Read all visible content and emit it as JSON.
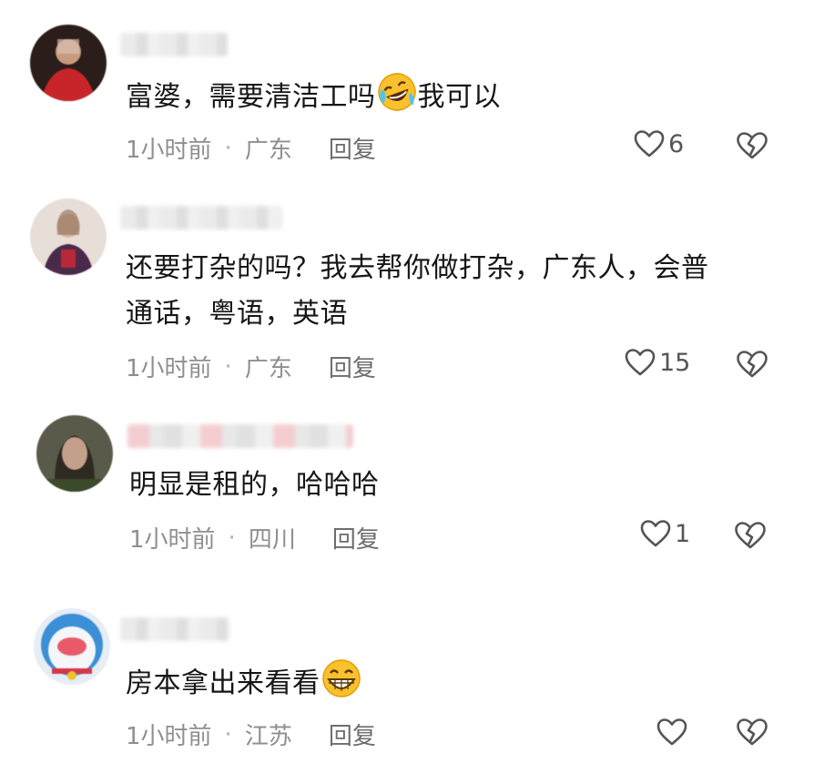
{
  "comments": [
    {
      "text": "富婆，需要清洁工吗",
      "text_after": "我可以",
      "emoji": "rolling-on-floor-laughing",
      "time": "1小时前",
      "location": "广东",
      "reply": "回复",
      "likes": "6"
    },
    {
      "line1": "还要打杂的吗？我去帮你做打杂，广东人，会普",
      "line2": "通话，粤语，英语",
      "time": "1小时前",
      "location": "广东",
      "reply": "回复",
      "likes": "15"
    },
    {
      "text": "明显是租的，哈哈哈",
      "time": "1小时前",
      "location": "四川",
      "reply": "回复",
      "likes": "1"
    },
    {
      "text": "房本拿出来看看",
      "emoji": "grinning-face",
      "time": "1小时前",
      "location": "江苏",
      "reply": "回复",
      "likes": ""
    }
  ],
  "colors": {
    "text": "#161616",
    "meta": "#8f8f8f",
    "icon": "#555555"
  }
}
